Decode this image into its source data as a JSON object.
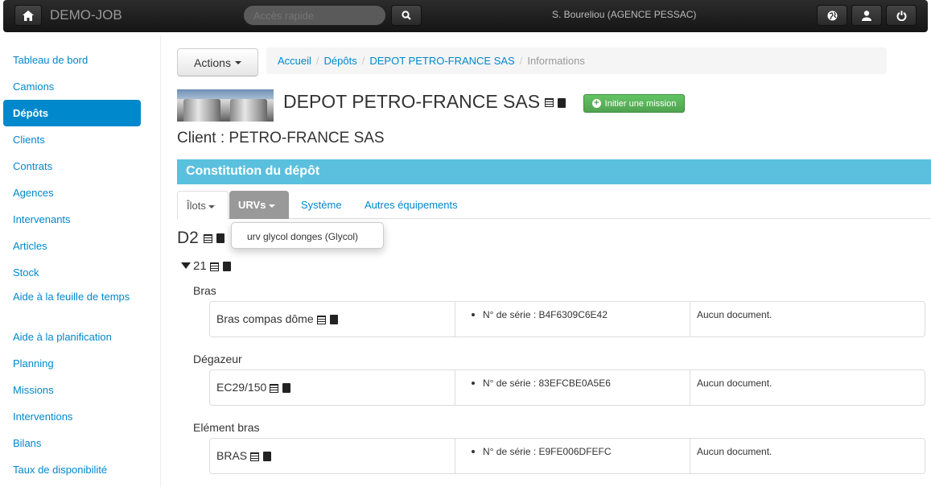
{
  "navbar": {
    "brand": "DEMO-JOB",
    "quick_access_placeholder": "Accès rapide",
    "user": "S. Boureliou (AGENCE PESSAC)",
    "icons": [
      "home-icon",
      "search-icon",
      "globe-icon",
      "user-icon",
      "power-icon"
    ]
  },
  "sidebar": {
    "items": [
      {
        "label": "Tableau de bord"
      },
      {
        "label": "Camions"
      },
      {
        "label": "Dépôts",
        "active": true
      },
      {
        "label": "Clients"
      },
      {
        "label": "Contrats"
      },
      {
        "label": "Agences"
      },
      {
        "label": "Intervenants"
      },
      {
        "label": "Articles"
      },
      {
        "label": "Stock"
      },
      {
        "label": "Aide à la feuille de temps"
      },
      {
        "label": "Aide à la planification"
      },
      {
        "label": "Planning"
      },
      {
        "label": "Missions"
      },
      {
        "label": "Interventions"
      },
      {
        "label": "Bilans"
      },
      {
        "label": "Taux de disponibilité"
      }
    ]
  },
  "actions": {
    "label": "Actions"
  },
  "breadcrumb": {
    "items": [
      "Accueil",
      "Dépôts",
      "DEPOT PETRO-FRANCE SAS"
    ],
    "current": "Informations"
  },
  "header": {
    "title": "DEPOT PETRO-FRANCE SAS",
    "mission_button": "Initier une mission",
    "client_line": "Client : PETRO-FRANCE SAS"
  },
  "section": {
    "title": "Constitution du dépôt"
  },
  "tabs": {
    "ilots": "Îlots",
    "urvs": "URVs",
    "systeme": "Système",
    "autres": "Autres équipements"
  },
  "urv_dropdown": {
    "items": [
      "urv glycol donges (Glycol)"
    ]
  },
  "ilot": {
    "name": "D2",
    "sub": "21"
  },
  "groups": [
    {
      "label": "Bras",
      "name": "Bras compas dôme",
      "serial": "N° de série : B4F6309C6E42",
      "docs": "Aucun document."
    },
    {
      "label": "Dégazeur",
      "name": "EC29/150",
      "serial": "N° de série : 83EFCBE0A5E6",
      "docs": "Aucun document."
    },
    {
      "label": "Elément bras",
      "name": "BRAS",
      "serial": "N° de série : E9FE006DFEFC",
      "docs": "Aucun document."
    }
  ],
  "colors": {
    "link": "#0088cc",
    "section_bar": "#5bc0de",
    "success": "#51a351",
    "active_tab": "#999999"
  }
}
